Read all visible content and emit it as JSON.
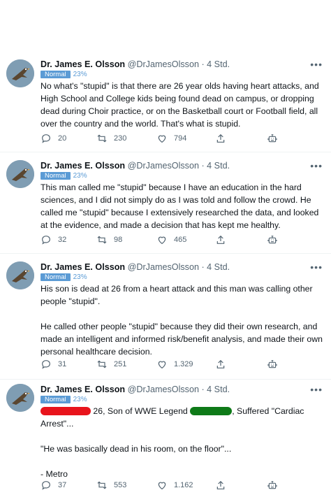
{
  "tweets": [
    {
      "name": "Dr. James E. Olsson",
      "handle": "@DrJamesOlsson",
      "time": " · 4 Std.",
      "badge": "Normal",
      "pct": "23%",
      "paragraphs": [
        "No what's \"stupid\" is that there are 26 year olds having heart attacks, and High School and College kids being found dead on campus, or dropping dead during Choir practice, or on the Basketball court or Football field, all over the country and the world. That's what is stupid."
      ],
      "replies": "20",
      "retweets": "230",
      "likes": "794"
    },
    {
      "name": "Dr. James E. Olsson",
      "handle": "@DrJamesOlsson",
      "time": " · 4 Std.",
      "badge": "Normal",
      "pct": "23%",
      "paragraphs": [
        "This man called me \"stupid\" because I have an education in the hard sciences, and I did not simply do as I was told and follow the crowd. He called me \"stupid\" because I extensively researched the data, and looked at the evidence, and made a decision that has kept me healthy."
      ],
      "replies": "32",
      "retweets": "98",
      "likes": "465"
    },
    {
      "name": "Dr. James E. Olsson",
      "handle": "@DrJamesOlsson",
      "time": " · 4 Std.",
      "badge": "Normal",
      "pct": "23%",
      "paragraphs": [
        "His son is dead at 26 from a heart attack and this man was calling other people \"stupid\".",
        "He called other people \"stupid\" because they did their own research, and made an intelligent and informed risk/benefit analysis, and made their own personal healthcare decision."
      ],
      "replies": "31",
      "retweets": "251",
      "likes": "1.329"
    },
    {
      "name": "Dr. James E. Olsson",
      "handle": "@DrJamesOlsson",
      "time": " · 4 Std.",
      "badge": "Normal",
      "pct": "23%",
      "line1_a": " 26, Son of WWE Legend ",
      "line1_b": ", Suffered \"Cardiac",
      "line2": "Arrest\"...",
      "quote": "\"He was basically dead in his room, on the floor\"...",
      "source": "- Metro",
      "replies": "37",
      "retweets": "553",
      "likes": "1.162"
    }
  ],
  "colors": {
    "badge": "#5b9bd5",
    "muted": "#536471",
    "redaction_red": "#e8141c",
    "redaction_green": "#0e7a18"
  },
  "icons": [
    "more-icon",
    "reply-icon",
    "retweet-icon",
    "like-icon",
    "share-icon",
    "bot-icon"
  ]
}
